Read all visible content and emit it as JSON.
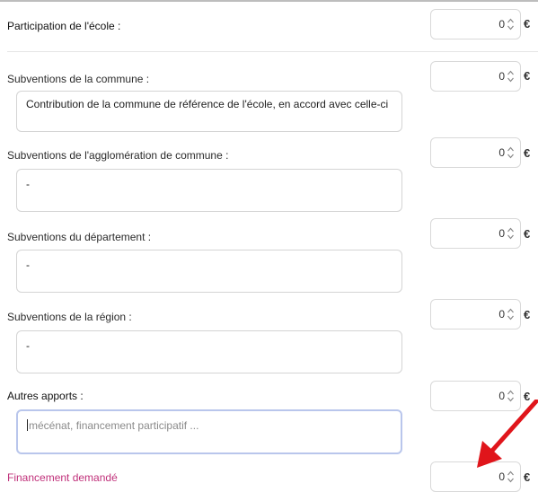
{
  "currency_symbol": "€",
  "rows": [
    {
      "label": "Participation de l'école :",
      "value": "0"
    },
    {
      "label": "Subventions de la commune :",
      "value": "0",
      "text": "Contribution de la commune de référence de l'école, en accord avec celle-ci"
    },
    {
      "label": "Subventions de l'agglomération de commune :",
      "value": "0",
      "text": "-"
    },
    {
      "label": "Subventions du département :",
      "value": "0",
      "text": "-"
    },
    {
      "label": "Subventions de la région :",
      "value": "0",
      "text": "-"
    },
    {
      "label": "Autres apports :",
      "value": "0",
      "placeholder": "mécénat, financement participatif ..."
    },
    {
      "label": "Financement demandé",
      "value": "0"
    }
  ],
  "colors": {
    "annotation_arrow": "#e0151b",
    "financement_label": "#c0307a",
    "focus_border": "#b9c6ec"
  },
  "icons": {
    "spinner": "up-down-spinner-icon",
    "annotation": "red-arrow-icon"
  }
}
